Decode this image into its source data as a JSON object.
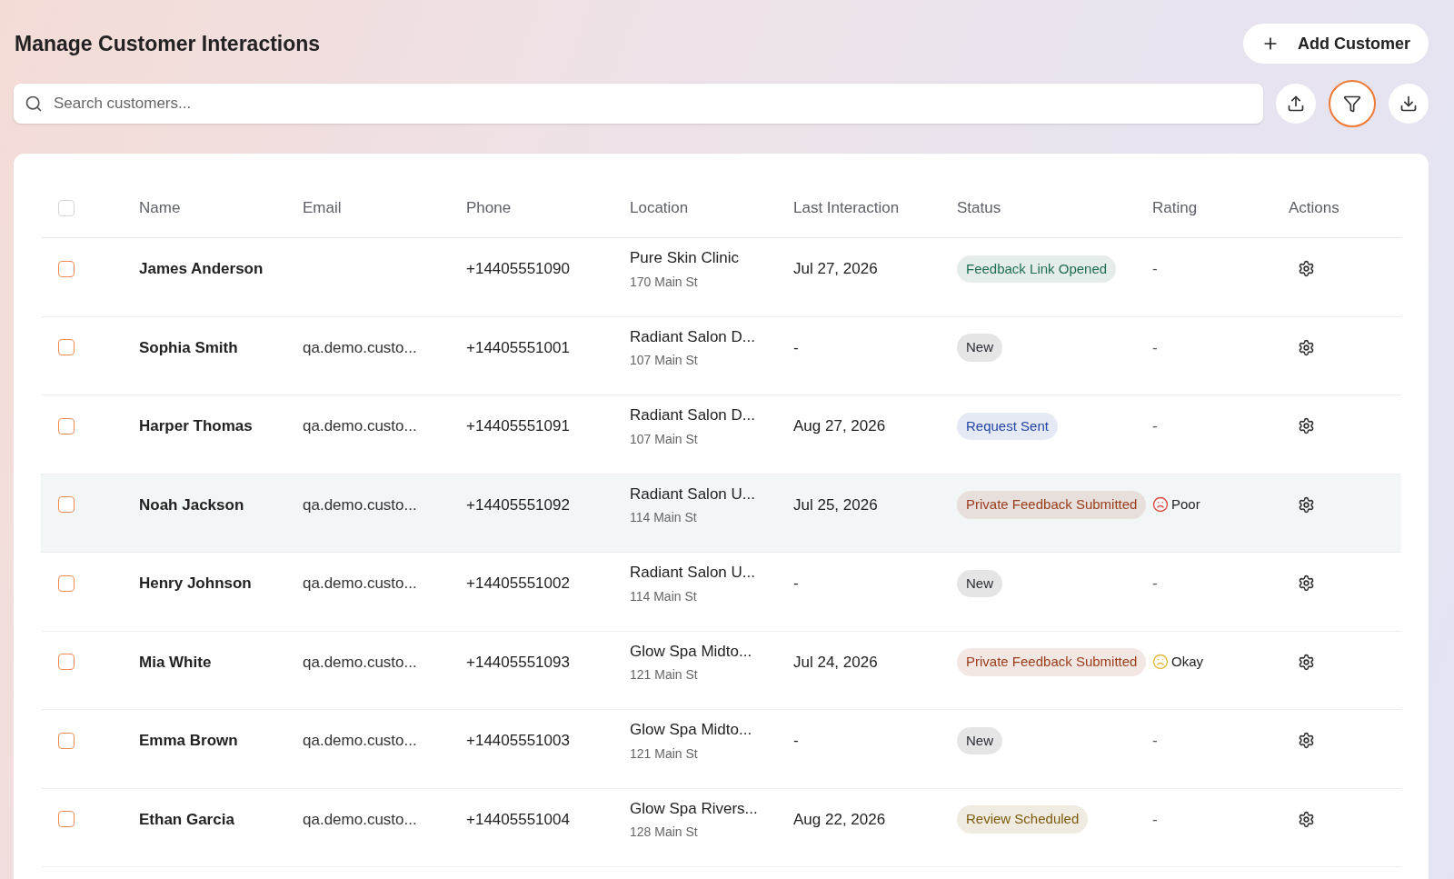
{
  "page": {
    "title": "Manage Customer Interactions",
    "add_button": "Add Customer"
  },
  "search": {
    "placeholder": "Search customers..."
  },
  "toolbar": {
    "filter_active": true
  },
  "table": {
    "select_all_checked": false,
    "columns": [
      "Name",
      "Email",
      "Phone",
      "Location",
      "Last Interaction",
      "Status",
      "Rating",
      "Actions"
    ],
    "rows": [
      {
        "checked": false,
        "hovered": false,
        "name": "James Anderson",
        "phone": "+14405551090",
        "location": "Pure Skin Clinic",
        "address": "170 Main St",
        "last_interaction": "Jul 27, 2026",
        "status": {
          "label": "Feedback Link Opened",
          "color": "#1f6e50"
        },
        "rating": {
          "label": "-"
        }
      },
      {
        "checked": false,
        "hovered": false,
        "name": "Sophia Smith",
        "email": "qa.demo.custo...",
        "phone": "+14405551001",
        "location": "Radiant Salon D...",
        "address": "107 Main St",
        "last_interaction": "-",
        "status": {
          "label": "New",
          "color": "#2a2d33"
        },
        "rating": {
          "label": "-"
        }
      },
      {
        "checked": false,
        "hovered": false,
        "name": "Harper Thomas",
        "email": "qa.demo.custo...",
        "phone": "+14405551091",
        "location": "Radiant Salon D...",
        "address": "107 Main St",
        "last_interaction": "Aug 27, 2026",
        "status": {
          "label": "Request Sent",
          "color": "#2446a8"
        },
        "rating": {
          "label": "-"
        }
      },
      {
        "checked": false,
        "hovered": true,
        "name": "Noah Jackson",
        "email": "qa.demo.custo...",
        "phone": "+14405551092",
        "location": "Radiant Salon U...",
        "address": "114 Main St",
        "last_interaction": "Jul 25, 2026",
        "status": {
          "label": "Private Feedback Submitted",
          "color": "#9a3d1c"
        },
        "rating": {
          "label": "Poor",
          "color": "#e0473f"
        }
      },
      {
        "checked": false,
        "hovered": false,
        "name": "Henry Johnson",
        "email": "qa.demo.custo...",
        "phone": "+14405551002",
        "location": "Radiant Salon U...",
        "address": "114 Main St",
        "last_interaction": "-",
        "status": {
          "label": "New",
          "color": "#2a2d33"
        },
        "rating": {
          "label": "-"
        }
      },
      {
        "checked": false,
        "hovered": false,
        "name": "Mia White",
        "email": "qa.demo.custo...",
        "phone": "+14405551093",
        "location": "Glow Spa Midto...",
        "address": "121 Main St",
        "last_interaction": "Jul 24, 2026",
        "status": {
          "label": "Private Feedback Submitted",
          "color": "#9a3d1c"
        },
        "rating": {
          "label": "Okay",
          "color": "#e5b83a"
        }
      },
      {
        "checked": false,
        "hovered": false,
        "name": "Emma Brown",
        "email": "qa.demo.custo...",
        "phone": "+14405551003",
        "location": "Glow Spa Midto...",
        "address": "121 Main St",
        "last_interaction": "-",
        "status": {
          "label": "New",
          "color": "#2a2d33"
        },
        "rating": {
          "label": "-"
        }
      },
      {
        "checked": false,
        "hovered": false,
        "name": "Ethan Garcia",
        "email": "qa.demo.custo...",
        "phone": "+14405551004",
        "location": "Glow Spa Rivers...",
        "address": "128 Main St",
        "last_interaction": "Aug 22, 2026",
        "status": {
          "label": "Review Scheduled",
          "color": "#7d5a0c"
        },
        "rating": {
          "label": "-"
        }
      }
    ]
  }
}
